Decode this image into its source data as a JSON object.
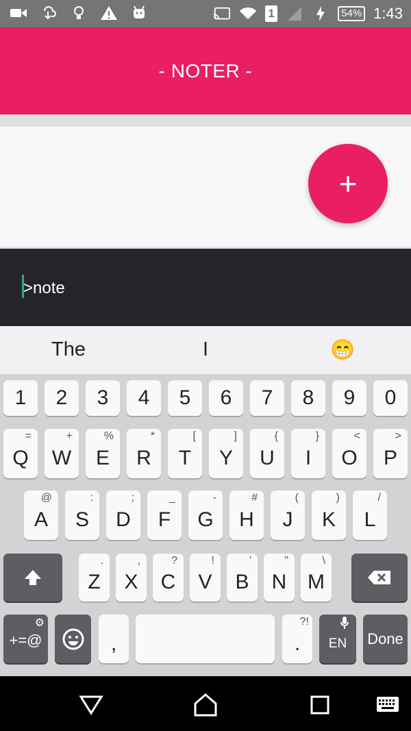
{
  "status_bar": {
    "time": "1:43",
    "battery": "54%",
    "sim": "1",
    "icons": [
      "video-icon",
      "download-icon",
      "bulb-icon",
      "warning-icon",
      "android-icon",
      "cast-icon",
      "wifi-icon",
      "signal-icon",
      "charging-icon"
    ]
  },
  "app": {
    "title": "- NOTER -",
    "accent": "#e91e63"
  },
  "fab": {
    "label": "+"
  },
  "input": {
    "value": ">note"
  },
  "suggestions": [
    "The",
    "I",
    "😁"
  ],
  "keyboard": {
    "numbers": [
      "1",
      "2",
      "3",
      "4",
      "5",
      "6",
      "7",
      "8",
      "9",
      "0"
    ],
    "row1": [
      {
        "k": "Q",
        "h": "="
      },
      {
        "k": "W",
        "h": "+"
      },
      {
        "k": "E",
        "h": "%"
      },
      {
        "k": "R",
        "h": "*"
      },
      {
        "k": "T",
        "h": "["
      },
      {
        "k": "Y",
        "h": "]"
      },
      {
        "k": "U",
        "h": "{"
      },
      {
        "k": "I",
        "h": "}"
      },
      {
        "k": "O",
        "h": "<"
      },
      {
        "k": "P",
        "h": ">"
      }
    ],
    "row2": [
      {
        "k": "A",
        "h": "@"
      },
      {
        "k": "S",
        "h": ":"
      },
      {
        "k": "D",
        "h": ";"
      },
      {
        "k": "F",
        "h": "_"
      },
      {
        "k": "G",
        "h": "-"
      },
      {
        "k": "H",
        "h": "#"
      },
      {
        "k": "J",
        "h": "("
      },
      {
        "k": "K",
        "h": ")"
      },
      {
        "k": "L",
        "h": "/"
      }
    ],
    "row3": [
      {
        "k": "Z",
        "h": "."
      },
      {
        "k": "X",
        "h": ","
      },
      {
        "k": "C",
        "h": "?"
      },
      {
        "k": "V",
        "h": "!"
      },
      {
        "k": "B",
        "h": "'"
      },
      {
        "k": "N",
        "h": "\""
      },
      {
        "k": "M",
        "h": "\\"
      }
    ],
    "symbols_label": "+=@",
    "comma": ",",
    "period": ".",
    "period_hint": "?!",
    "lang": "EN",
    "done": "Done"
  }
}
